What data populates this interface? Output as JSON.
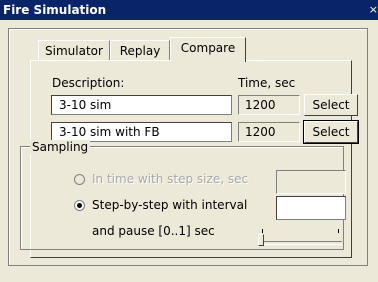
{
  "window": {
    "title": "Fire Simulation",
    "close_glyph": "×"
  },
  "tabs": [
    {
      "label": "Simulator",
      "active": false
    },
    {
      "label": "Replay",
      "active": false
    },
    {
      "label": "Compare",
      "active": true
    }
  ],
  "compare": {
    "description_header": "Description:",
    "time_header": "Time, sec",
    "rows": [
      {
        "description": "3-10 sim",
        "time": "1200",
        "button": "Select",
        "focused": false
      },
      {
        "description": "3-10 sim with FB",
        "time": "1200",
        "button": "Select",
        "focused": true
      }
    ]
  },
  "sampling": {
    "group_label": "Sampling",
    "option_time": {
      "label": "In time with step size, sec",
      "selected": false,
      "enabled": false,
      "value": ""
    },
    "option_step": {
      "label": "Step-by-step with interval",
      "selected": true,
      "enabled": true,
      "value": ""
    },
    "pause_label": "and pause [0..1] sec",
    "pause_value": 0
  }
}
